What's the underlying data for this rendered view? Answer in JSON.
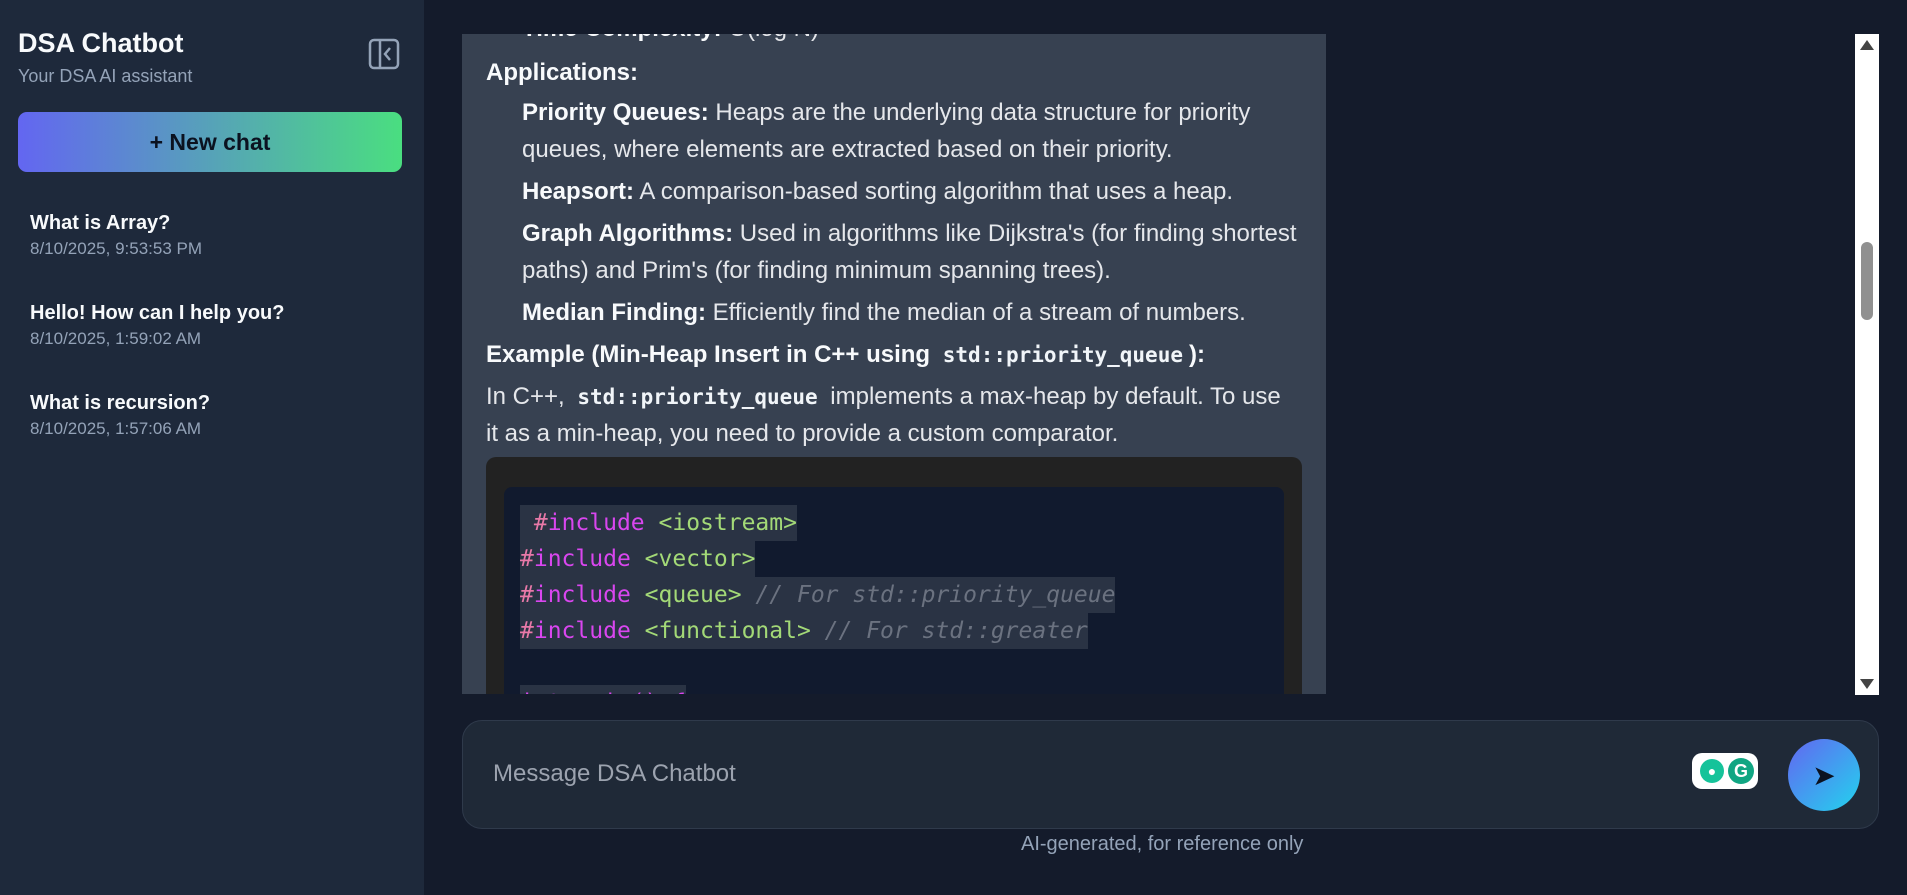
{
  "sidebar": {
    "title": "DSA Chatbot",
    "subtitle": "Your DSA AI assistant",
    "toggle_icon": "sidebar-collapse-icon",
    "new_chat_label": "+ New chat",
    "history": [
      {
        "title": "What is Array?",
        "date": "8/10/2025, 9:53:53 PM"
      },
      {
        "title": "Hello! How can I help you?",
        "date": "8/10/2025, 1:59:02 AM"
      },
      {
        "title": "What is recursion?",
        "date": "8/10/2025, 1:57:06 AM"
      }
    ]
  },
  "message": {
    "cut_top": {
      "label": "Time Complexity:",
      "text": " O(log N)"
    },
    "applications_heading": "Applications:",
    "applications": [
      {
        "label": "Priority Queues:",
        "text1": " Heaps are the underlying data structure for priority",
        "text2": "queues, where elements are extracted based on their priority."
      },
      {
        "label": "Heapsort:",
        "text1": " A comparison-based sorting algorithm that uses a heap.",
        "text2": ""
      },
      {
        "label": "Graph Algorithms:",
        "text1": " Used in algorithms like Dijkstra's (for finding shortest",
        "text2": "paths) and Prim's (for finding minimum spanning trees)."
      },
      {
        "label": "Median Finding:",
        "text1": " Efficiently find the median of a stream of numbers.",
        "text2": ""
      }
    ],
    "example_heading_pre": "Example (Min-Heap Insert in C++ using ",
    "example_heading_code": "std::priority_queue",
    "example_heading_post": "):",
    "para_pre": "In C++, ",
    "para_code": "std::priority_queue",
    "para_post": " implements a max-heap by default. To use",
    "para_line2": "it as a min-heap, you need to provide a custom comparator.",
    "code": [
      {
        "hash": "#",
        "kw": "include",
        "hdr": " <iostream>",
        "comment": ""
      },
      {
        "hash": "#",
        "kw": "include",
        "hdr": " <vector>",
        "comment": ""
      },
      {
        "hash": "#",
        "kw": "include",
        "hdr": " <queue>",
        "comment": " // For std::priority_queue"
      },
      {
        "hash": "#",
        "kw": "include",
        "hdr": " <functional>",
        "comment": " // For std::greater"
      }
    ],
    "code_cut_line": "int main() {"
  },
  "composer": {
    "placeholder": "Message DSA Chatbot",
    "send_icon": "send-arrow-icon",
    "send_glyph": "➤",
    "grammarly_icon": "grammarly-icon"
  },
  "disclaimer": "AI-generated, for reference only"
}
